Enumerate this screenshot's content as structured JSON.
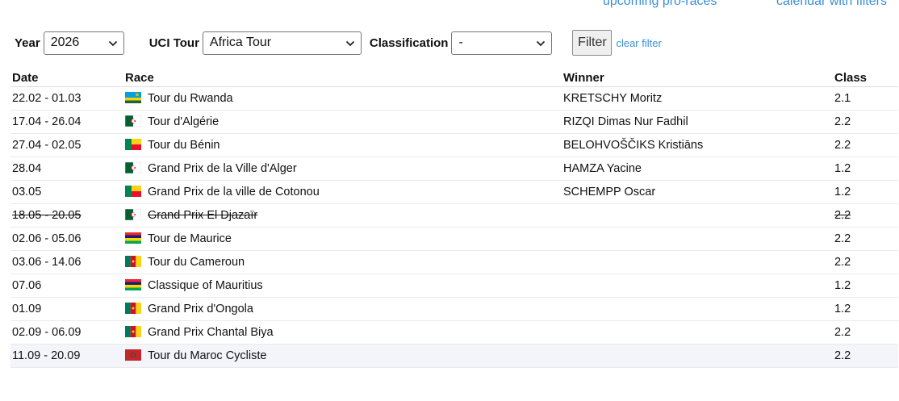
{
  "top_links": {
    "upcoming": "upcoming pro-races",
    "calendar": "calendar with filters"
  },
  "filters": {
    "year_label": "Year",
    "year_value": "2026",
    "tour_label": "UCI Tour",
    "tour_value": "Africa Tour",
    "class_label": "Classification",
    "class_value": "-",
    "filter_button": "Filter",
    "clear_filter": "clear filter"
  },
  "table": {
    "headers": {
      "date": "Date",
      "race": "Race",
      "winner": "Winner",
      "class": "Class"
    },
    "rows": [
      {
        "date": "22.02 - 01.03",
        "race": "Tour du Rwanda",
        "winner": "KRETSCHY Moritz",
        "class": "2.1",
        "flag": "rwanda-flag"
      },
      {
        "date": "17.04 - 26.04",
        "race": "Tour d'Algérie",
        "winner": "RIZQI Dimas Nur Fadhil",
        "class": "2.2",
        "flag": "algeria-flag"
      },
      {
        "date": "27.04 - 02.05",
        "race": "Tour du Bénin",
        "winner": "BELOHVOŠČIKS Kristiāns",
        "class": "2.2",
        "flag": "benin-flag"
      },
      {
        "date": "28.04",
        "race": "Grand Prix de la Ville d'Alger",
        "winner": "HAMZA Yacine",
        "class": "1.2",
        "flag": "algeria-flag"
      },
      {
        "date": "03.05",
        "race": "Grand Prix de la ville de Cotonou",
        "winner": "SCHEMPP Oscar",
        "class": "1.2",
        "flag": "benin-flag"
      },
      {
        "date": "18.05 - 20.05",
        "race": "Grand Prix El Djazaïr",
        "winner": "",
        "class": "2.2",
        "flag": "algeria-flag",
        "cancelled": true
      },
      {
        "date": "02.06 - 05.06",
        "race": "Tour de Maurice",
        "winner": "",
        "class": "2.2",
        "flag": "mauritius-flag"
      },
      {
        "date": "03.06 - 14.06",
        "race": "Tour du Cameroun",
        "winner": "",
        "class": "2.2",
        "flag": "cameroon-flag"
      },
      {
        "date": "07.06",
        "race": "Classique of Mauritius",
        "winner": "",
        "class": "1.2",
        "flag": "mauritius-flag"
      },
      {
        "date": "01.09",
        "race": "Grand Prix d'Ongola",
        "winner": "",
        "class": "1.2",
        "flag": "cameroon-flag"
      },
      {
        "date": "02.09 - 06.09",
        "race": "Grand Prix Chantal Biya",
        "winner": "",
        "class": "2.2",
        "flag": "cameroon-flag"
      },
      {
        "date": "11.09 - 20.09",
        "race": "Tour du Maroc Cycliste",
        "winner": "",
        "class": "2.2",
        "flag": "morocco-flag"
      }
    ]
  }
}
